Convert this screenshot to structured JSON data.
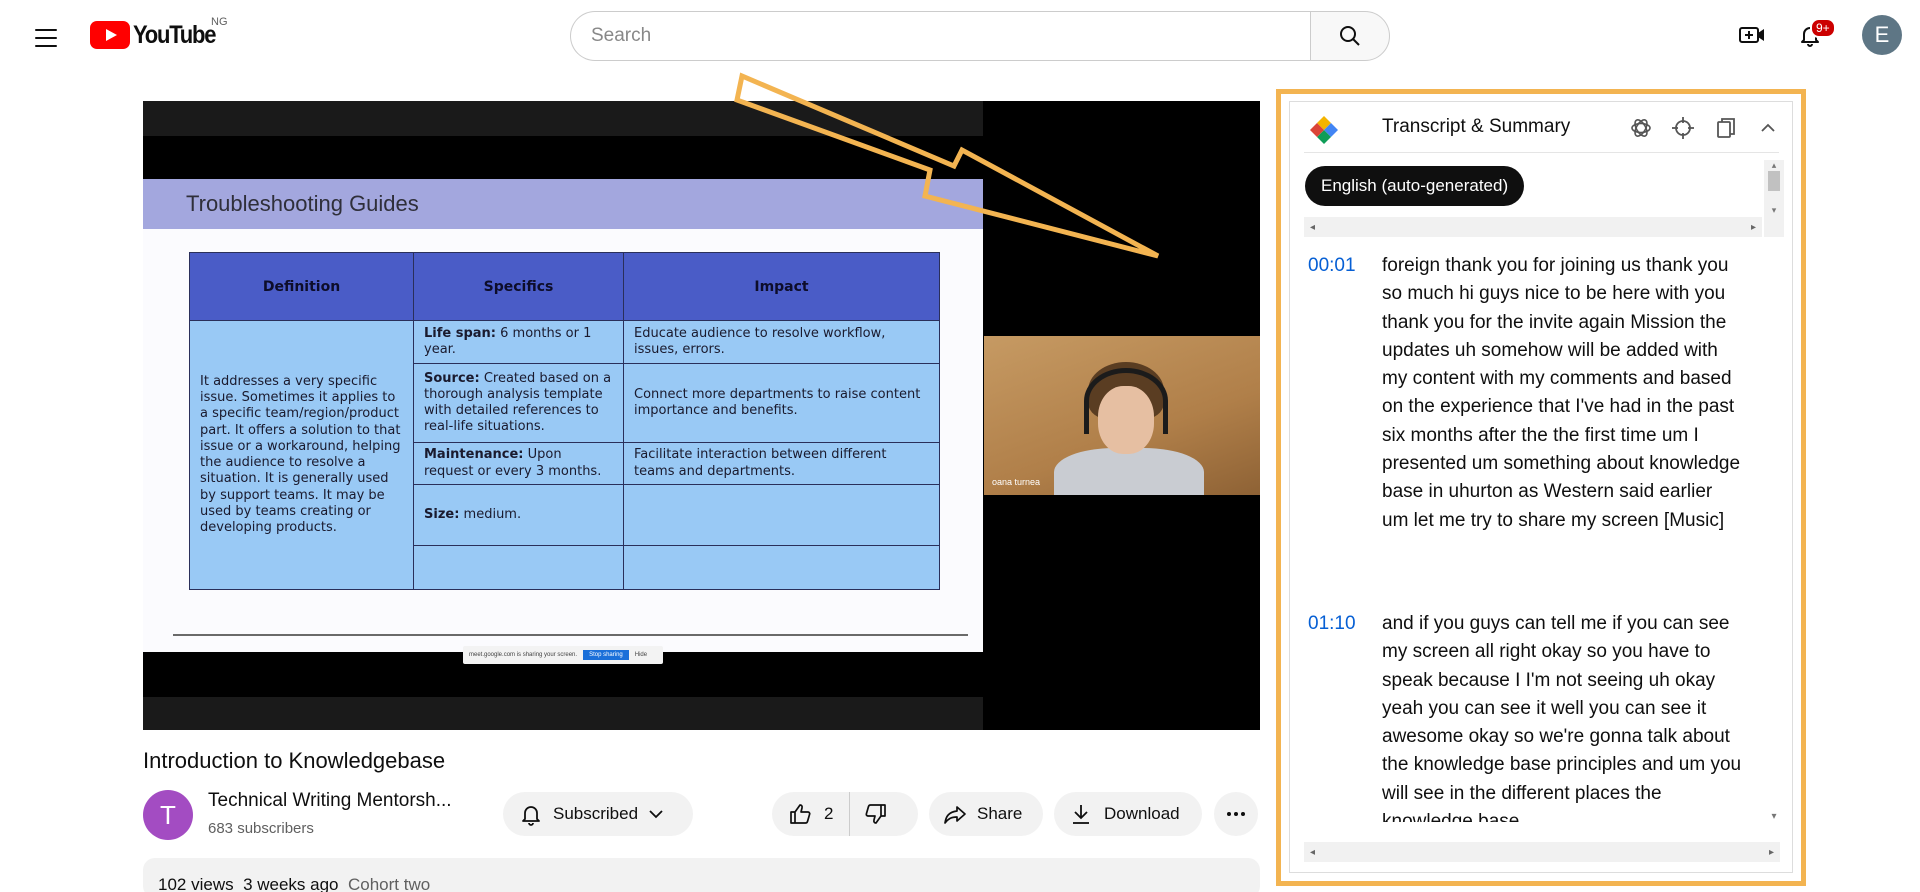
{
  "header": {
    "logo_text": "YouTube",
    "region": "NG",
    "search_placeholder": "Search",
    "notification_count": "9+",
    "avatar_letter": "E"
  },
  "video": {
    "slide_title": "Troubleshooting Guides",
    "table_headers": [
      "Definition",
      "Specifics",
      "Impact"
    ],
    "definition": "It addresses a very specific issue. Sometimes it applies to a specific team/region/product part. It offers a solution to that issue or a workaround, helping the audience to resolve a situation. It is generally used by support teams. It may be used by teams creating or developing products.",
    "rows": [
      {
        "spec_label": "Life span:",
        "spec_text": " 6 months or 1 year.",
        "impact": "Educate audience to resolve workflow, issues, errors."
      },
      {
        "spec_label": "Source:",
        "spec_text": " Created based on a thorough analysis template with detailed references to real-life situations.",
        "impact": "Connect more departments to raise content importance and benefits."
      },
      {
        "spec_label": "Maintenance:",
        "spec_text": " Upon request or every 3 months.",
        "impact": "Facilitate interaction between different teams and departments."
      },
      {
        "spec_label": "Size:",
        "spec_text": " medium.",
        "impact": ""
      }
    ],
    "share_bar_text": "meet.google.com is sharing your screen.",
    "share_bar_button": "Stop sharing",
    "share_bar_hide": "Hide",
    "cam_name": "oana turnea",
    "title": "Introduction to Knowledgebase"
  },
  "channel": {
    "avatar_letter": "T",
    "name": "Technical Writing Mentorsh...",
    "subscribers": "683 subscribers",
    "subscribed_label": "Subscribed"
  },
  "actions": {
    "likes": "2",
    "share_label": "Share",
    "download_label": "Download"
  },
  "description": {
    "views": "102 views",
    "age": "3 weeks ago",
    "tag": "Cohort two"
  },
  "transcript": {
    "title": "Transcript & Summary",
    "language": "English (auto-generated)",
    "segments": [
      {
        "time": "00:01",
        "text": "foreign thank you for joining us thank you so much hi guys nice to be here with you thank you for the invite again Mission the updates uh somehow will be added with my content with my comments and based on the experience that I've had in the past six months after the the first time um I presented um something about knowledge base in uhurton as Western said earlier um let me try to share my screen [Music]"
      },
      {
        "time": "01:10",
        "text": "and if you guys can tell me if you can see my screen all right okay so you have to speak because I I'm not seeing uh okay yeah you can see it well you can see it awesome okay so we're gonna talk about the knowledge base principles and um you will see in the different places the knowledge base"
      }
    ]
  },
  "colors": {
    "accent": "#f3b451",
    "link": "#065fd4",
    "yt_red": "#ff0000"
  }
}
